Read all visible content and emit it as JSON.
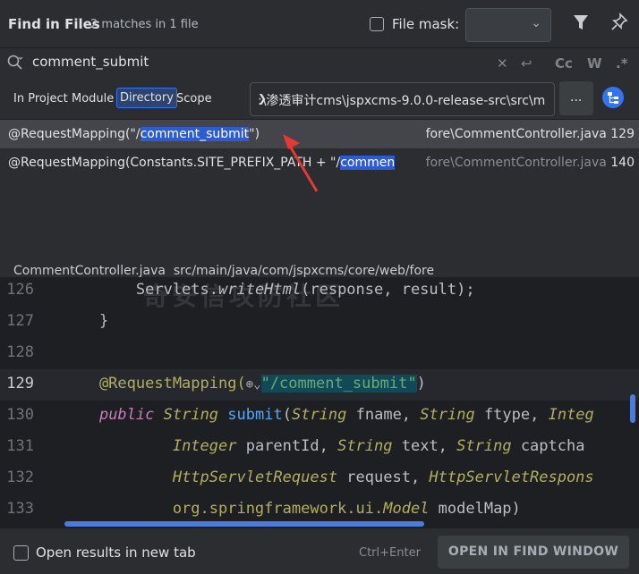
{
  "header": {
    "title": "Find in Files",
    "matches": "2 matches in 1 file",
    "file_mask_label": "File mask:"
  },
  "search": {
    "query": "comment_submit",
    "options": {
      "match_case": "Cc",
      "words": "W",
      "regex": ".*"
    }
  },
  "scope": {
    "tabs": [
      "In Project",
      "Module",
      "Directory",
      "Scope"
    ],
    "active": "Directory",
    "directory": ":\\渗透审计cms\\jspxcms-9.0.0-release-src\\src\\m",
    "browse_label": "..."
  },
  "results": [
    {
      "prefix": "@RequestMapping(\"/",
      "match": "comment_submit",
      "suffix": "\")",
      "file": "fore\\CommentController.java",
      "line": "129",
      "selected": true
    },
    {
      "prefix": "@RequestMapping(Constants.SITE_PREFIX_PATH + \"/",
      "match": "commen",
      "suffix": "",
      "file": "fore\\CommentController.java",
      "line": "140",
      "selected": false
    }
  ],
  "preview": {
    "file_name": "CommentController.java",
    "file_path": "src/main/java/com/jspxcms/core/web/fore",
    "watermark": "奇安信攻防社区",
    "lines": [
      {
        "num": "126",
        "parts": [
          {
            "t": "        Servlets.",
            "c": ""
          },
          {
            "t": "writeHtml",
            "c": "it"
          },
          {
            "t": "(response, result);",
            "c": ""
          }
        ]
      },
      {
        "num": "127",
        "parts": [
          {
            "t": "    }",
            "c": ""
          }
        ]
      },
      {
        "num": "128",
        "parts": [
          {
            "t": "",
            "c": ""
          }
        ]
      },
      {
        "num": "129",
        "parts": [
          {
            "t": "    @RequestMapping(",
            "c": "ann"
          },
          {
            "t": "⊕⌄",
            "c": "icon"
          },
          {
            "t": "\"/comment_submit\"",
            "c": "str str-hl"
          },
          {
            "t": ")",
            "c": ""
          }
        ],
        "current": true
      },
      {
        "num": "130",
        "parts": [
          {
            "t": "    ",
            "c": ""
          },
          {
            "t": "public",
            "c": "kw-purple"
          },
          {
            "t": " ",
            "c": ""
          },
          {
            "t": "String",
            "c": "cls"
          },
          {
            "t": " ",
            "c": ""
          },
          {
            "t": "submit",
            "c": "fn"
          },
          {
            "t": "(",
            "c": ""
          },
          {
            "t": "String",
            "c": "cls"
          },
          {
            "t": " fname, ",
            "c": ""
          },
          {
            "t": "String",
            "c": "cls"
          },
          {
            "t": " ftype, ",
            "c": ""
          },
          {
            "t": "Integ",
            "c": "cls"
          }
        ]
      },
      {
        "num": "131",
        "parts": [
          {
            "t": "            ",
            "c": ""
          },
          {
            "t": "Integer",
            "c": "cls"
          },
          {
            "t": " parentId, ",
            "c": ""
          },
          {
            "t": "String",
            "c": "cls"
          },
          {
            "t": " text, ",
            "c": ""
          },
          {
            "t": "String",
            "c": "cls"
          },
          {
            "t": " captcha",
            "c": ""
          }
        ]
      },
      {
        "num": "132",
        "parts": [
          {
            "t": "            ",
            "c": ""
          },
          {
            "t": "HttpServletRequest",
            "c": "cls"
          },
          {
            "t": " request, ",
            "c": ""
          },
          {
            "t": "HttpServletRespons",
            "c": "cls"
          }
        ]
      },
      {
        "num": "133",
        "parts": [
          {
            "t": "            org.springframework.ui.",
            "c": "cls-pkg"
          },
          {
            "t": "Model",
            "c": "cls"
          },
          {
            "t": " modelMap)",
            "c": ""
          }
        ]
      }
    ]
  },
  "footer": {
    "open_in_new_tab": "Open results in new tab",
    "shortcut": "Ctrl+Enter",
    "open_button": "OPEN IN FIND WINDOW"
  },
  "colors": {
    "accent": "#3574f0",
    "match_highlight": "#2d5bd3",
    "annotation_arrow": "#e53935"
  }
}
